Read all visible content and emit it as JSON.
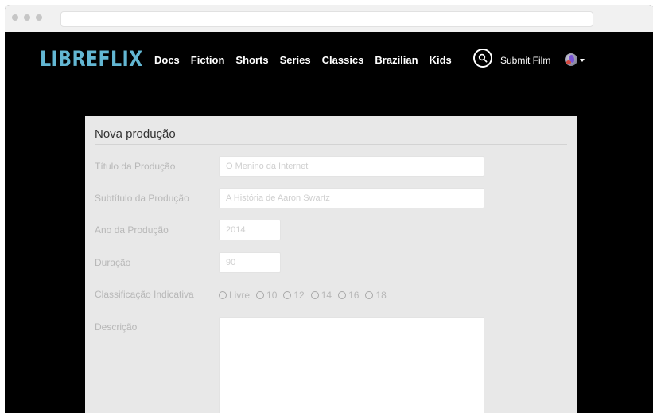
{
  "browser": {
    "url": ""
  },
  "brand": {
    "logo_text": "LIBREFLIX",
    "logo_color": "#63b7d3"
  },
  "nav": {
    "links": [
      "Docs",
      "Fiction",
      "Shorts",
      "Series",
      "Classics",
      "Brazilian",
      "Kids"
    ],
    "search_icon": "search-icon",
    "submit_film_label": "Submit Film",
    "language_icon": "globe-icon"
  },
  "form": {
    "title": "Nova produção",
    "fields": {
      "titulo": {
        "label": "Título da Produção",
        "placeholder": "O Menino da Internet"
      },
      "subtitulo": {
        "label": "Subtítulo da Produção",
        "placeholder": "A História de Aaron Swartz"
      },
      "ano": {
        "label": "Ano da Produção",
        "placeholder": "2014"
      },
      "duracao": {
        "label": "Duração",
        "placeholder": "90"
      },
      "classificacao": {
        "label": "Classificação Indicativa",
        "options": [
          "Livre",
          "10",
          "12",
          "14",
          "16",
          "18"
        ]
      },
      "descricao": {
        "label": "Descrição",
        "placeholder": ""
      }
    }
  }
}
